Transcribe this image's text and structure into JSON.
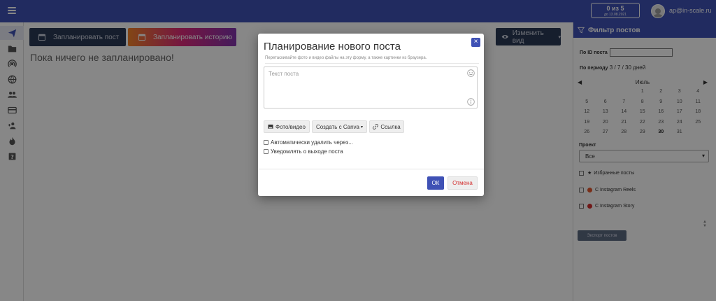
{
  "topbar": {
    "counter_main": "0 из 5",
    "counter_sub": "до 13.08.2021",
    "user_email": "ap@in-scale.ru"
  },
  "sidebar": {
    "items": [
      {
        "icon": "send-icon",
        "active": true
      },
      {
        "icon": "folder-icon",
        "active": false
      },
      {
        "icon": "broadcast-icon",
        "active": false
      },
      {
        "icon": "globe-icon",
        "active": false
      },
      {
        "icon": "users-icon",
        "active": false
      },
      {
        "icon": "credit-card-icon",
        "active": false
      },
      {
        "icon": "add-user-icon",
        "active": false
      },
      {
        "icon": "fire-icon",
        "active": false
      },
      {
        "icon": "help-icon",
        "active": false
      }
    ]
  },
  "main": {
    "plan_post_label": "Запланировать пост",
    "plan_story_label": "Запланировать историю",
    "change_view_label": "Изменить вид",
    "empty_message": "Пока ничего не запланировано!"
  },
  "filter": {
    "title": "Фильтр постов",
    "id_label": "По ID поста",
    "period_label": "По периоду",
    "period_options": "3 / 7 / 30 дней",
    "month": "Июль",
    "calendar_rows": [
      [
        "",
        "",
        "",
        "",
        "1",
        "2",
        "3",
        "4"
      ],
      [
        "5",
        "6",
        "7",
        "8",
        "9",
        "10",
        "11"
      ],
      [
        "12",
        "13",
        "14",
        "15",
        "16",
        "17",
        "18"
      ],
      [
        "19",
        "20",
        "21",
        "22",
        "23",
        "24",
        "25"
      ],
      [
        "26",
        "27",
        "28",
        "29",
        "30",
        "31",
        ""
      ]
    ],
    "project_label": "Проект",
    "project_value": "Все",
    "favorites_label": "Избранные посты",
    "reels_label": "С Instagram Reels",
    "story_label": "С Instagram Story",
    "export_label": "Экспорт постов"
  },
  "modal": {
    "title": "Планирование нового поста",
    "hint": "Перетаскивайте фото и видео файлы на эту форму, а также картинки из браузера.",
    "text_placeholder": "Текст поста",
    "photo_video_label": "Фото/видео",
    "canva_label": "Создать с Canva",
    "link_label": "Ссылка",
    "auto_delete_label": "Автоматически удалить через...",
    "notify_label": "Уведомлять о выходе поста",
    "ok_label": "ОК",
    "cancel_label": "Отмена"
  },
  "colors": {
    "brand": "#3f51b5",
    "dark_button": "#2b3a55",
    "cancel_text": "#d32f2f"
  }
}
